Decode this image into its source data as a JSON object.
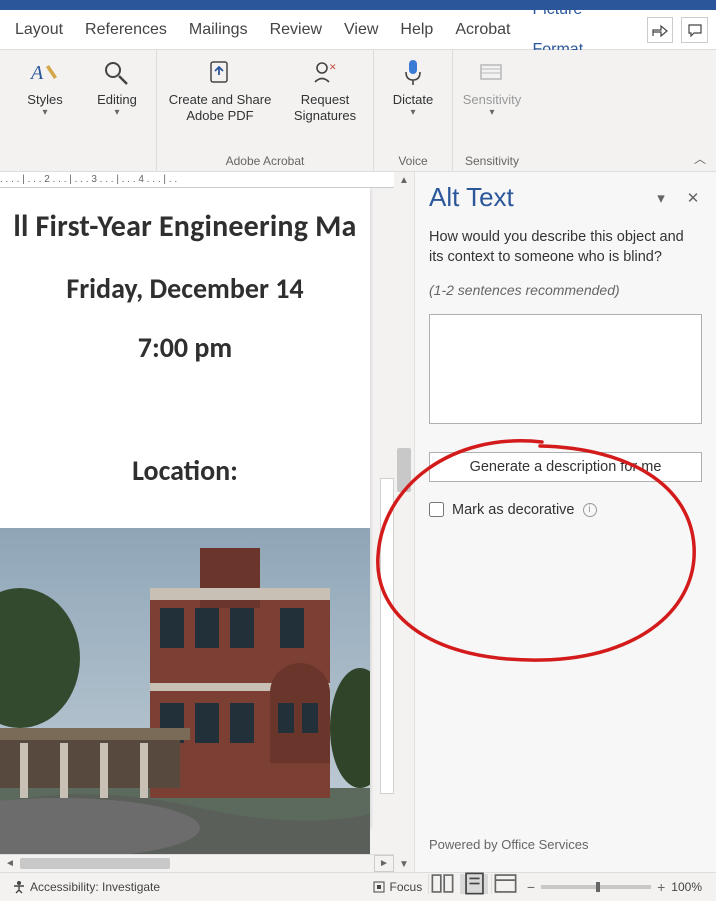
{
  "tabs": {
    "layout": "Layout",
    "references": "References",
    "mailings": "Mailings",
    "review": "Review",
    "view": "View",
    "help": "Help",
    "acrobat": "Acrobat",
    "picture_format": "Picture Format"
  },
  "ribbon": {
    "styles": {
      "label": "Styles"
    },
    "editing": {
      "label": "Editing"
    },
    "adobe": {
      "create_share": "Create and Share\nAdobe PDF",
      "request_sig": "Request\nSignatures",
      "group": "Adobe Acrobat"
    },
    "dictate": {
      "label": "Dictate",
      "group": "Voice"
    },
    "sensitivity": {
      "label": "Sensitivity",
      "group": "Sensitivity"
    }
  },
  "ruler_text": ". . . . | . . . 2 . . . | . . . 3 . . . | . . . 4 . . . | . .",
  "doc": {
    "line1": "ll First-Year Engineering Ma",
    "line2": "Friday, December 14",
    "line3": "7:00 pm",
    "line4": "Location:"
  },
  "alt_text": {
    "title": "Alt Text",
    "desc": "How would you describe this object and its context to someone who is blind?",
    "hint": "(1-2 sentences recommended)",
    "value": "",
    "generate": "Generate a description for me",
    "decorative": "Mark as decorative",
    "powered": "Powered by Office Services"
  },
  "status": {
    "accessibility": "Accessibility: Investigate",
    "focus": "Focus",
    "zoom": "100%"
  }
}
